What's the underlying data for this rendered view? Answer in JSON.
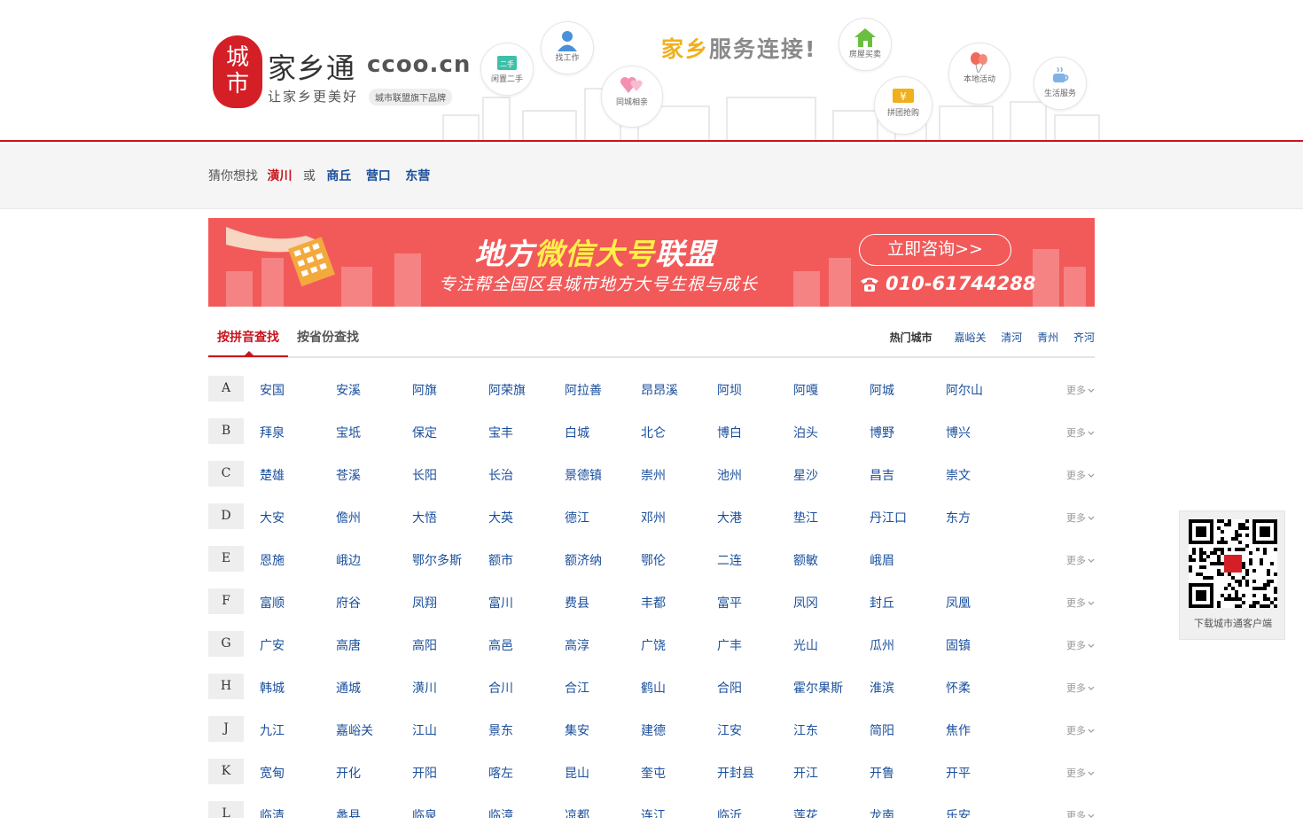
{
  "header": {
    "logo": {
      "seal_text": "城市",
      "name": "家乡通",
      "domain": "ccoo.cn",
      "slogan": "让家乡更美好",
      "brand_tag": "城市联盟旗下品牌"
    },
    "headline_highlight": "家乡",
    "headline_rest": "服务连接!",
    "services": [
      {
        "label": "闲置二手",
        "icon": "secondhand-tag-icon"
      },
      {
        "label": "找工作",
        "icon": "person-icon"
      },
      {
        "label": "同城相亲",
        "icon": "hearts-icon"
      },
      {
        "label": "房屋买卖",
        "icon": "house-icon"
      },
      {
        "label": "拼团抢购",
        "icon": "yen-coupon-icon"
      },
      {
        "label": "本地活动",
        "icon": "balloons-icon"
      },
      {
        "label": "生活服务",
        "icon": "coffee-cup-icon"
      }
    ]
  },
  "guess": {
    "prefix": "猜你想找",
    "primary": "潢川",
    "or": "或",
    "alternatives": [
      "商丘",
      "营口",
      "东营"
    ]
  },
  "banner": {
    "title_part1": "地方",
    "title_highlight": "微信大号",
    "title_part2": "联盟",
    "subtitle": "专注帮全国区县城市地方大号生根与成长",
    "cta": "立即咨询>>",
    "phone": "010-61744288"
  },
  "tabs": {
    "items": [
      "按拼音查找",
      "按省份查找"
    ],
    "active_index": 0,
    "hot_label": "热门城市",
    "hot_cities": [
      "嘉峪关",
      "清河",
      "青州",
      "齐河"
    ]
  },
  "more_label": "更多",
  "city_rows": [
    {
      "letter": "A",
      "cities": [
        "安国",
        "安溪",
        "阿旗",
        "阿荣旗",
        "阿拉善",
        "昂昂溪",
        "阿坝",
        "阿嘎",
        "阿城",
        "阿尔山"
      ]
    },
    {
      "letter": "B",
      "cities": [
        "拜泉",
        "宝坻",
        "保定",
        "宝丰",
        "白城",
        "北仑",
        "博白",
        "泊头",
        "博野",
        "博兴"
      ]
    },
    {
      "letter": "C",
      "cities": [
        "楚雄",
        "苍溪",
        "长阳",
        "长治",
        "景德镇",
        "崇州",
        "池州",
        "星沙",
        "昌吉",
        "崇文"
      ]
    },
    {
      "letter": "D",
      "cities": [
        "大安",
        "儋州",
        "大悟",
        "大英",
        "德江",
        "邓州",
        "大港",
        "垫江",
        "丹江口",
        "东方"
      ]
    },
    {
      "letter": "E",
      "cities": [
        "恩施",
        "峨边",
        "鄂尔多斯",
        "额市",
        "额济纳",
        "鄂伦",
        "二连",
        "额敏",
        "峨眉"
      ]
    },
    {
      "letter": "F",
      "cities": [
        "富顺",
        "府谷",
        "凤翔",
        "富川",
        "费县",
        "丰都",
        "富平",
        "凤冈",
        "封丘",
        "凤凰"
      ]
    },
    {
      "letter": "G",
      "cities": [
        "广安",
        "高唐",
        "高阳",
        "高邑",
        "高淳",
        "广饶",
        "广丰",
        "光山",
        "瓜州",
        "固镇"
      ]
    },
    {
      "letter": "H",
      "cities": [
        "韩城",
        "通城",
        "潢川",
        "合川",
        "合江",
        "鹤山",
        "合阳",
        "霍尔果斯",
        "淮滨",
        "怀柔"
      ]
    },
    {
      "letter": "J",
      "cities": [
        "九江",
        "嘉峪关",
        "江山",
        "景东",
        "集安",
        "建德",
        "江安",
        "江东",
        "简阳",
        "焦作"
      ]
    },
    {
      "letter": "K",
      "cities": [
        "宽甸",
        "开化",
        "开阳",
        "喀左",
        "昆山",
        "奎屯",
        "开封县",
        "开江",
        "开鲁",
        "开平"
      ]
    },
    {
      "letter": "L",
      "cities": [
        "临清",
        "蠡县",
        "临泉",
        "临漳",
        "凉都",
        "连江",
        "临沂",
        "莲花",
        "龙南",
        "乐安"
      ]
    }
  ],
  "qr_panel": {
    "caption": "下载城市通客户端"
  },
  "colors": {
    "brand_red": "#c9151e",
    "link_blue": "#1a4f9c",
    "banner_red": "#f25a5a",
    "highlight_yellow": "#fff04a"
  }
}
